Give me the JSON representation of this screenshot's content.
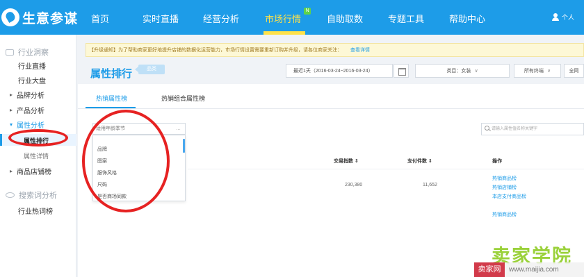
{
  "app": {
    "logo": "生意参谋"
  },
  "nav": {
    "items": [
      "首页",
      "实时直播",
      "经营分析",
      "市场行情",
      "自助取数",
      "专题工具",
      "帮助中心"
    ],
    "active": "市场行情",
    "user": "个人"
  },
  "sidebar": {
    "section1": "行业洞察",
    "industry_live": "行业直播",
    "industry_board": "行业大盘",
    "brand": "品牌分析",
    "product": "产品分析",
    "attr": "属性分析",
    "attr_rank": "属性排行",
    "attr_detail": "属性详情",
    "shop": "商品店铺榜",
    "section2": "搜索词分析",
    "hot_words": "行业热词榜"
  },
  "notice": {
    "text": "【升级通知】为了帮助商家更好地提升店铺的数据化运营能力，市场行情设置需要重新订购并升级，请各位商家关注：",
    "link": "查看详情"
  },
  "header": {
    "title": "属性排行",
    "tag": "品类",
    "date_range": "最近1天（2016-03-24~2016-03-24）",
    "category": "类目：女装",
    "terminal": "所有终端",
    "more": "全网"
  },
  "tabs": [
    "热销属性榜",
    "热销组合属性榜"
  ],
  "dropdown": {
    "value": "适用年龄季节",
    "options": [
      "品牌",
      "图案",
      "服饰风格",
      "尺码",
      "是否商场同款"
    ]
  },
  "search": {
    "placeholder": "请输入属性值名称关键字"
  },
  "table": {
    "headers": {
      "trade_index": "交易指数 ⇕",
      "pay_count": "支付件数 ⇕",
      "action": "操作"
    },
    "row": {
      "trade_index": "230,380",
      "pay_count": "11,652"
    },
    "actions": [
      "热销商品榜",
      "热销店铺榜",
      "本店支付商品榜",
      "热销商品榜"
    ]
  },
  "watermark": {
    "main": "卖家学院",
    "tag": "卖家网",
    "url": "www.maijia.com"
  },
  "colors": {
    "nav_blue": "#1d9ce8",
    "active_yellow": "#ffe24a",
    "annotation_red": "#e62222"
  }
}
